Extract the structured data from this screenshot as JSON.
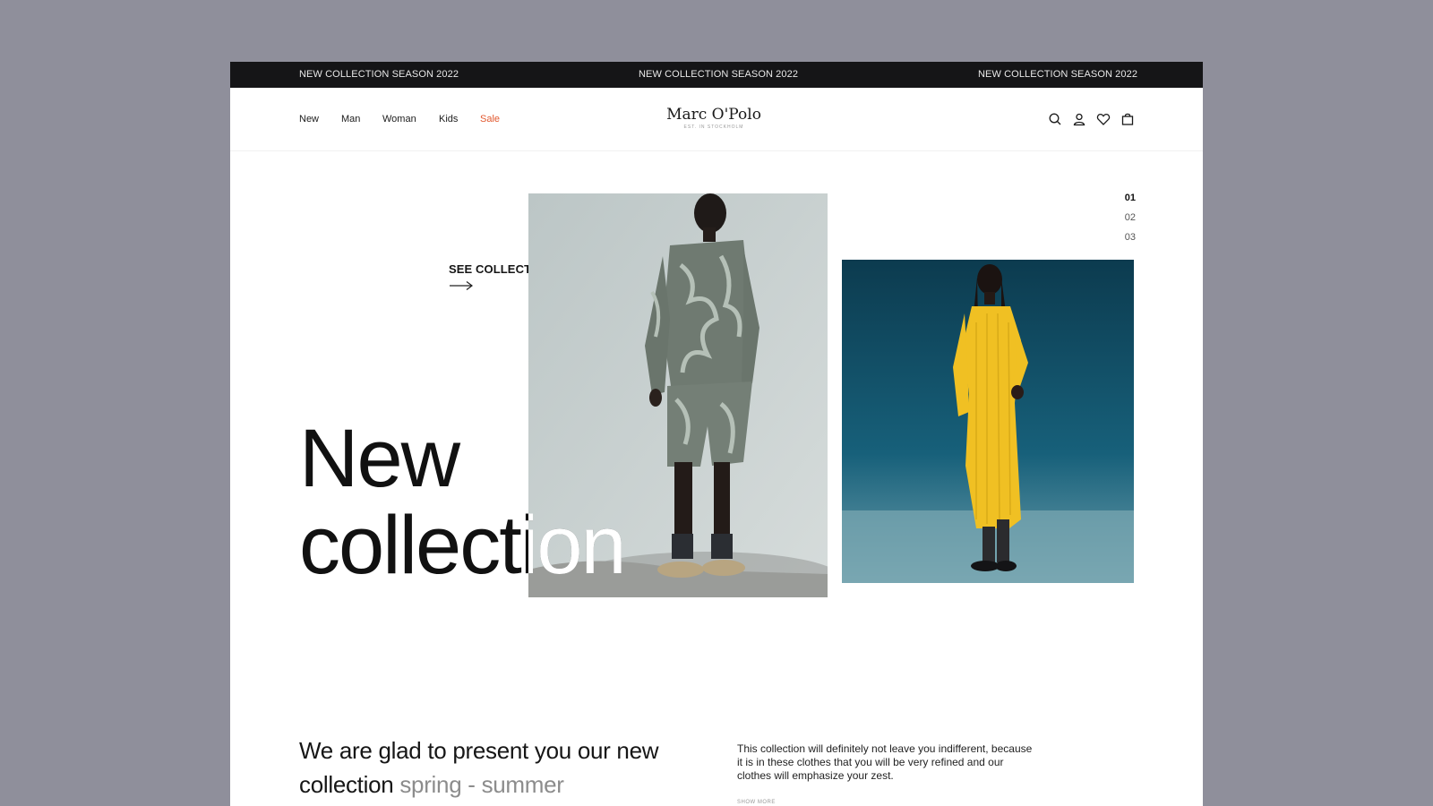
{
  "ticker": {
    "messages": [
      "NEW COLLECTION SEASON 2022",
      "NEW COLLECTION SEASON 2022",
      "NEW COLLECTION SEASON 2022"
    ]
  },
  "nav": {
    "items": [
      {
        "label": "New"
      },
      {
        "label": "Man"
      },
      {
        "label": "Woman"
      },
      {
        "label": "Kids"
      },
      {
        "label": "Sale"
      }
    ],
    "sale_color": "#e2582e"
  },
  "logo": {
    "name": "Marc O'Polo",
    "tagline": "EST. IN STOCKHOLM"
  },
  "header_icons": [
    "search-icon",
    "user-icon",
    "heart-icon",
    "bag-icon"
  ],
  "slider": {
    "numbers": [
      "01",
      "02",
      "03"
    ],
    "active": "01"
  },
  "hero": {
    "cta_label": "SEE COLLECTION",
    "title_line1": "New",
    "title_line2": "collection"
  },
  "intro": {
    "heading_main": "We are glad to present you our new collection",
    "heading_accent": "spring - summer",
    "description": "This collection will definitely not leave you indifferent, because it is in these clothes that you will be very refined and our clothes will emphasize your zest.",
    "show_more": "SHOW MORE"
  },
  "colors": {
    "page_bg": "#8f8f9b",
    "ticker_bg": "#151517",
    "accent": "#e2582e"
  }
}
